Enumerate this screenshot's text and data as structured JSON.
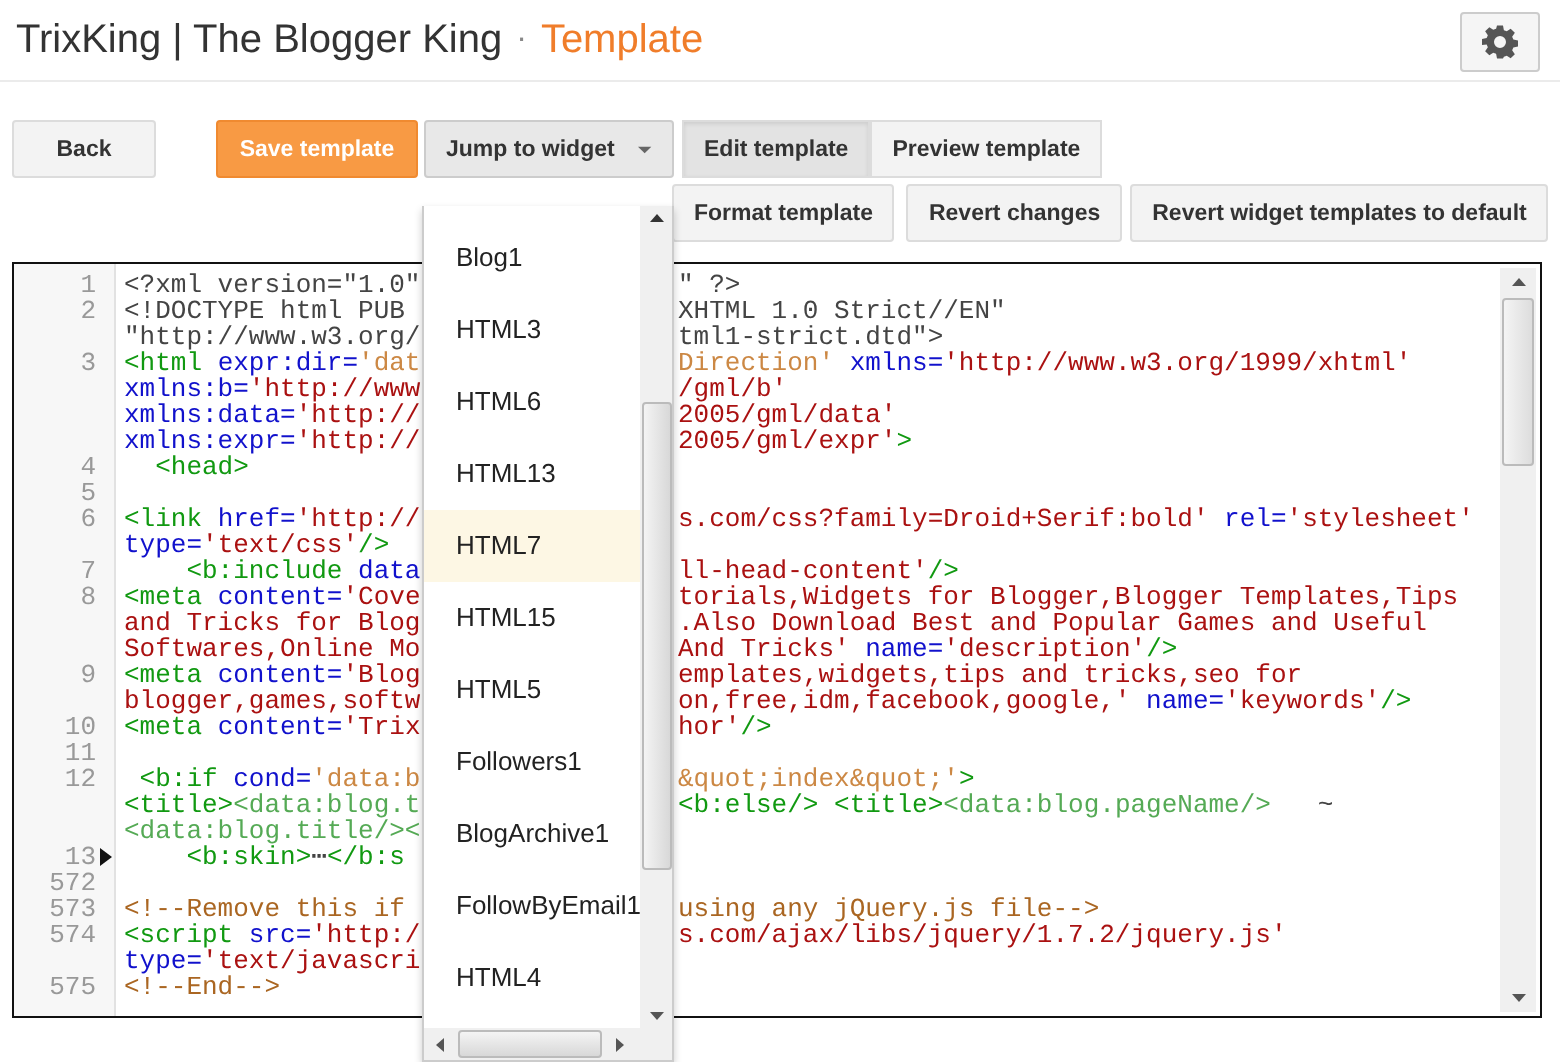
{
  "header": {
    "blog_title": "TrixKing | The Blogger King",
    "separator": "·",
    "page_title": "Template"
  },
  "buttons": [
    {
      "label": "Back",
      "kind": "plain"
    },
    {
      "label": "Save template",
      "kind": "primary"
    },
    {
      "label": "Jump to widget",
      "kind": "menu",
      "expanded": true
    }
  ],
  "view_tabs": [
    {
      "label": "Edit template",
      "selected": true
    },
    {
      "label": "Preview template",
      "selected": false
    }
  ],
  "actions": [
    {
      "label": "Format template"
    },
    {
      "label": "Revert changes"
    },
    {
      "label": "Revert widget templates to default"
    }
  ],
  "widget_menu": {
    "items": [
      {
        "label": "Blog1",
        "selected": false
      },
      {
        "label": "HTML3",
        "selected": false
      },
      {
        "label": "HTML6",
        "selected": false
      },
      {
        "label": "HTML13",
        "selected": false
      },
      {
        "label": "HTML7",
        "selected": true
      },
      {
        "label": "HTML15",
        "selected": false
      },
      {
        "label": "HTML5",
        "selected": false
      },
      {
        "label": "Followers1",
        "selected": false
      },
      {
        "label": "BlogArchive1",
        "selected": false
      },
      {
        "label": "FollowByEmail1",
        "selected": false
      },
      {
        "label": "HTML4",
        "selected": false
      }
    ]
  },
  "editor": {
    "lines": [
      {
        "number": "1",
        "folded": false,
        "left": [
          {
            "kind": "pi",
            "text": "<?xml version=\"1.0\""
          }
        ],
        "right": [
          {
            "kind": "pi",
            "text": "\" ?>"
          }
        ]
      },
      {
        "number": "2",
        "folded": false,
        "left": [
          {
            "kind": "pi",
            "text": "<!DOCTYPE html PUB"
          }
        ],
        "right": [
          {
            "kind": "pi",
            "text": "XHTML 1.0 Strict//EN\""
          }
        ]
      },
      {
        "folded": false,
        "left": [
          {
            "kind": "pi",
            "text": "\"http://www.w3.org/"
          }
        ],
        "right": [
          {
            "kind": "pi",
            "text": "tml1-strict.dtd\">"
          }
        ]
      },
      {
        "number": "3",
        "folded": false,
        "left": [
          {
            "kind": "tag",
            "text": "<html"
          },
          {
            "kind": "attr",
            "text": " expr:dir="
          },
          {
            "kind": "expr",
            "text": "'dat"
          }
        ],
        "right": [
          {
            "kind": "expr",
            "text": "Direction'"
          },
          {
            "kind": "attr",
            "text": " xmlns="
          },
          {
            "kind": "value",
            "text": "'http://www.w3.org/1999/xhtml'"
          }
        ]
      },
      {
        "folded": false,
        "left": [
          {
            "kind": "attr",
            "text": "xmlns:b="
          },
          {
            "kind": "value",
            "text": "'http://www"
          }
        ],
        "right": [
          {
            "kind": "value",
            "text": "/gml/b'"
          }
        ]
      },
      {
        "folded": false,
        "left": [
          {
            "kind": "attr",
            "text": "xmlns:data="
          },
          {
            "kind": "value",
            "text": "'http://"
          }
        ],
        "right": [
          {
            "kind": "value",
            "text": "2005/gml/data'"
          }
        ]
      },
      {
        "folded": false,
        "left": [
          {
            "kind": "attr",
            "text": "xmlns:expr="
          },
          {
            "kind": "value",
            "text": "'http://"
          }
        ],
        "right": [
          {
            "kind": "value",
            "text": "2005/gml/expr'"
          },
          {
            "kind": "tag",
            "text": ">"
          }
        ]
      },
      {
        "number": "4",
        "folded": false,
        "left": [
          {
            "kind": "tag",
            "text": "  <head>"
          }
        ]
      },
      {
        "number": "5",
        "folded": false
      },
      {
        "number": "6",
        "folded": false,
        "left": [
          {
            "kind": "tag",
            "text": "<link"
          },
          {
            "kind": "attr",
            "text": " href="
          },
          {
            "kind": "value",
            "text": "'http://"
          }
        ],
        "right": [
          {
            "kind": "value",
            "text": "s.com/css?family=Droid+Serif:bold'"
          },
          {
            "kind": "attr",
            "text": " rel="
          },
          {
            "kind": "value",
            "text": "'stylesheet'"
          }
        ]
      },
      {
        "folded": false,
        "left": [
          {
            "kind": "attr",
            "text": "type="
          },
          {
            "kind": "value",
            "text": "'text/css'"
          },
          {
            "kind": "tag",
            "text": "/>"
          }
        ]
      },
      {
        "number": "7",
        "folded": false,
        "left": [
          {
            "kind": "tag",
            "text": "    <b:include"
          },
          {
            "kind": "attr",
            "text": " data"
          }
        ],
        "right": [
          {
            "kind": "value",
            "text": "ll-head-content'"
          },
          {
            "kind": "tag",
            "text": "/>"
          }
        ]
      },
      {
        "number": "8",
        "folded": false,
        "left": [
          {
            "kind": "tag",
            "text": "<meta"
          },
          {
            "kind": "attr",
            "text": " content="
          },
          {
            "kind": "value",
            "text": "'Cove"
          }
        ],
        "right": [
          {
            "kind": "value",
            "text": "torials,Widgets for Blogger,Blogger Templates,Tips"
          }
        ]
      },
      {
        "folded": false,
        "left": [
          {
            "kind": "value",
            "text": "and Tricks for Blog"
          }
        ],
        "right": [
          {
            "kind": "value",
            "text": ".Also Download Best and Popular Games and Useful"
          }
        ]
      },
      {
        "folded": false,
        "left": [
          {
            "kind": "value",
            "text": "Softwares,Online Mo"
          }
        ],
        "right": [
          {
            "kind": "value",
            "text": "And Tricks'"
          },
          {
            "kind": "attr",
            "text": " name="
          },
          {
            "kind": "value",
            "text": "'description'"
          },
          {
            "kind": "tag",
            "text": "/>"
          }
        ]
      },
      {
        "number": "9",
        "folded": false,
        "left": [
          {
            "kind": "tag",
            "text": "<meta"
          },
          {
            "kind": "attr",
            "text": " content="
          },
          {
            "kind": "value",
            "text": "'Blog"
          }
        ],
        "right": [
          {
            "kind": "value",
            "text": "emplates,widgets,tips and tricks,seo for"
          }
        ]
      },
      {
        "folded": false,
        "left": [
          {
            "kind": "value",
            "text": "blogger,games,softw"
          }
        ],
        "right": [
          {
            "kind": "value",
            "text": "on,free,idm,facebook,google,'"
          },
          {
            "kind": "attr",
            "text": " name="
          },
          {
            "kind": "value",
            "text": "'keywords'"
          },
          {
            "kind": "tag",
            "text": "/>"
          }
        ]
      },
      {
        "number": "10",
        "folded": false,
        "left": [
          {
            "kind": "tag",
            "text": "<meta"
          },
          {
            "kind": "attr",
            "text": " content="
          },
          {
            "kind": "value",
            "text": "'Trix"
          }
        ],
        "right": [
          {
            "kind": "value",
            "text": "hor'"
          },
          {
            "kind": "tag",
            "text": "/>"
          }
        ]
      },
      {
        "number": "11",
        "folded": false
      },
      {
        "number": "12",
        "folded": false,
        "left": [
          {
            "kind": "tag",
            "text": " <b:if"
          },
          {
            "kind": "attr",
            "text": " cond="
          },
          {
            "kind": "expr",
            "text": "'data:b"
          }
        ],
        "right": [
          {
            "kind": "expr",
            "text": "&quot;index&quot;'"
          },
          {
            "kind": "tag",
            "text": ">"
          }
        ]
      },
      {
        "folded": false,
        "left": [
          {
            "kind": "tag",
            "text": "<title>"
          },
          {
            "kind": "data",
            "text": "<data:blog.t"
          }
        ],
        "right": [
          {
            "kind": "tag",
            "text": "<b:else/> <title>"
          },
          {
            "kind": "data",
            "text": "<data:blog.pageName/>"
          },
          {
            "kind": "pi",
            "text": "   ~"
          }
        ]
      },
      {
        "folded": false,
        "left": [
          {
            "kind": "data",
            "text": "<data:blog.title/><"
          }
        ]
      },
      {
        "number": "13",
        "folded": true,
        "left": [
          {
            "kind": "tag",
            "text": "    <b:skin>"
          },
          {
            "kind": "pi",
            "text": "⋯"
          },
          {
            "kind": "tag",
            "text": "</b:s"
          }
        ]
      },
      {
        "number": "572",
        "folded": false
      },
      {
        "number": "573",
        "folded": false,
        "left": [
          {
            "kind": "comment",
            "text": "<!--Remove this if"
          }
        ],
        "right": [
          {
            "kind": "comment",
            "text": "using any jQuery.js file-->"
          }
        ]
      },
      {
        "number": "574",
        "folded": false,
        "left": [
          {
            "kind": "tag",
            "text": "<script"
          },
          {
            "kind": "attr",
            "text": " src="
          },
          {
            "kind": "value",
            "text": "'http:/"
          }
        ],
        "right": [
          {
            "kind": "value",
            "text": "s.com/ajax/libs/jquery/1.7.2/jquery.js'"
          }
        ]
      },
      {
        "folded": false,
        "left": [
          {
            "kind": "attr",
            "text": "type="
          },
          {
            "kind": "value",
            "text": "'text/javascri"
          }
        ]
      },
      {
        "number": "575",
        "folded": false,
        "left": [
          {
            "kind": "comment",
            "text": "<!--End-->"
          }
        ]
      }
    ]
  }
}
